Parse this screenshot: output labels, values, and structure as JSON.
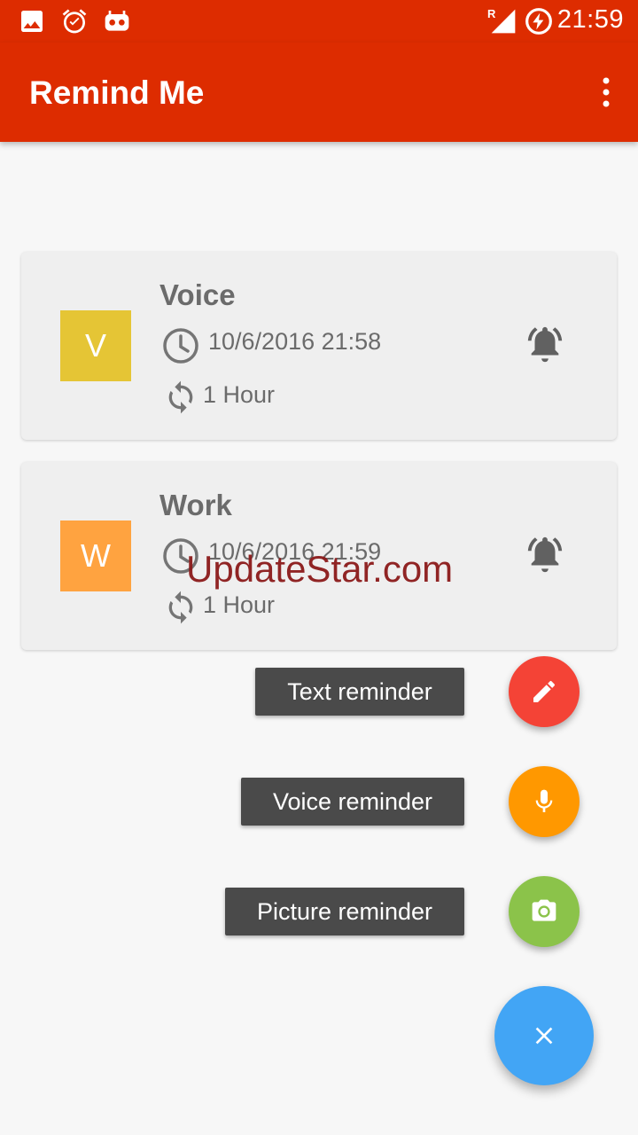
{
  "status_bar": {
    "time": "21:59",
    "network_indicator": "R",
    "icons": [
      "image-icon",
      "alarm-icon",
      "robot-icon",
      "signal-icon",
      "battery-charging-icon"
    ]
  },
  "app_bar": {
    "title": "Remind Me",
    "overflow_icon": "more-vert-icon"
  },
  "reminders": [
    {
      "avatar_letter": "V",
      "avatar_color": "#e5c535",
      "title": "Voice",
      "datetime": "10/6/2016 21:58",
      "repeat": "1 Hour"
    },
    {
      "avatar_letter": "W",
      "avatar_color": "#ffa340",
      "title": "Work",
      "datetime": "10/6/2016 21:59",
      "repeat": "1 Hour"
    }
  ],
  "watermark": "UpdateStar.com",
  "fab_menu": {
    "text_label": "Text reminder",
    "text_color": "#f44336",
    "voice_label": "Voice reminder",
    "voice_color": "#ff9800",
    "picture_label": "Picture reminder",
    "picture_color": "#8bc34a",
    "close_color": "#42a5f5"
  }
}
